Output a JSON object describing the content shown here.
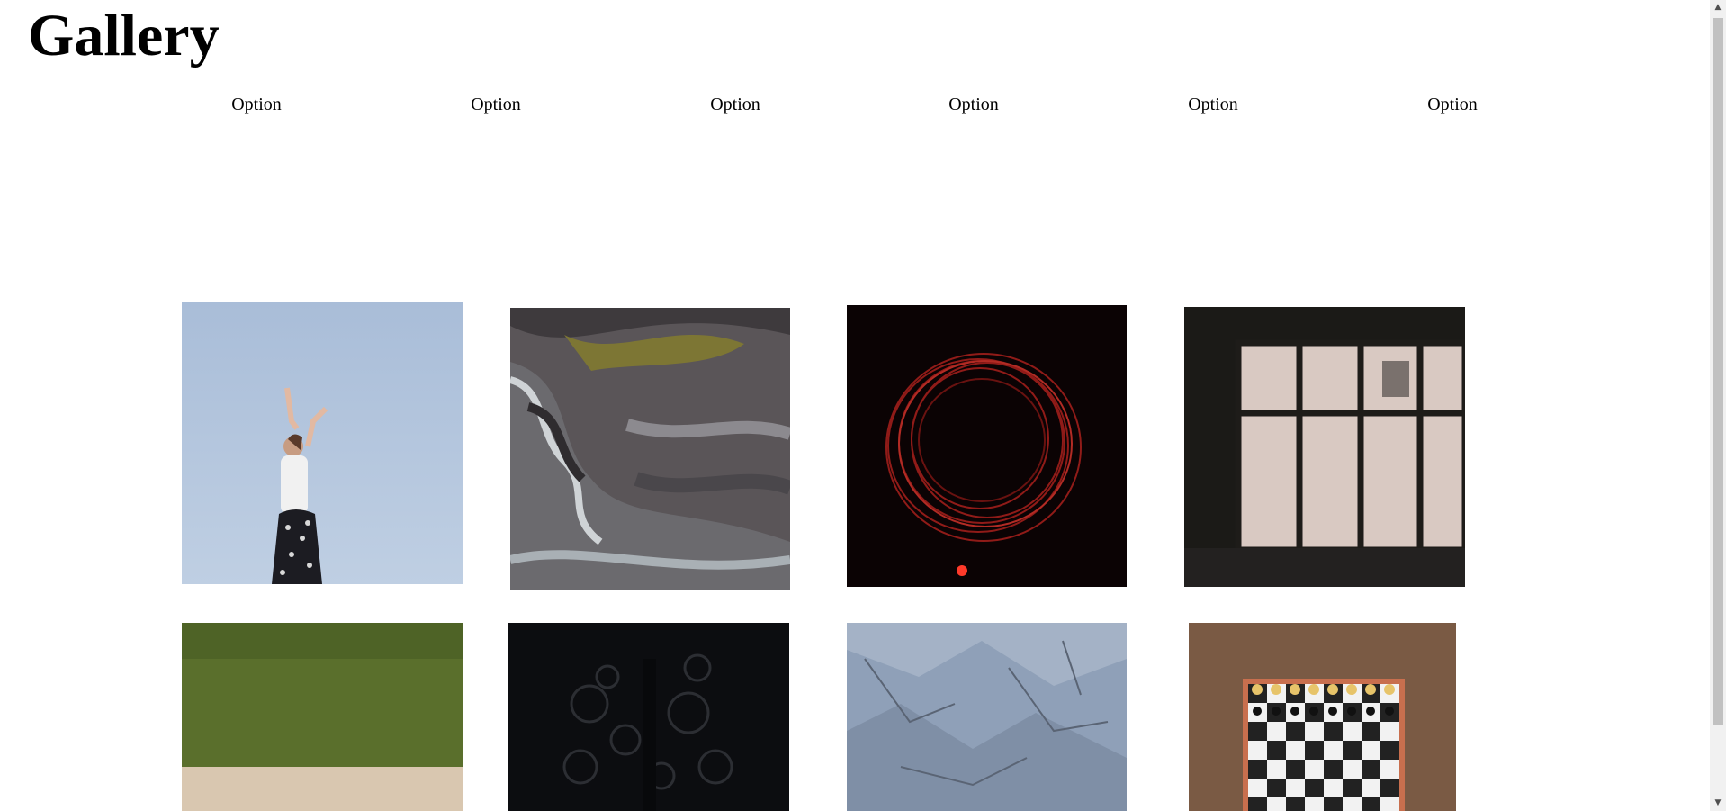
{
  "page": {
    "title": "Gallery"
  },
  "nav": {
    "items": [
      "Option",
      "Option",
      "Option",
      "Option",
      "Option",
      "Option"
    ]
  },
  "gallery": {
    "tiles": [
      {
        "name": "woman-sky-photo"
      },
      {
        "name": "marble-swirl-photo"
      },
      {
        "name": "red-light-circle-photo"
      },
      {
        "name": "window-photo"
      },
      {
        "name": "grass-field-photo"
      },
      {
        "name": "dark-texture-photo"
      },
      {
        "name": "rock-texture-photo"
      },
      {
        "name": "chessboard-photo"
      }
    ]
  },
  "scrollbar": {
    "up_icon": "arrow-up-icon",
    "down_icon": "arrow-down-icon"
  }
}
